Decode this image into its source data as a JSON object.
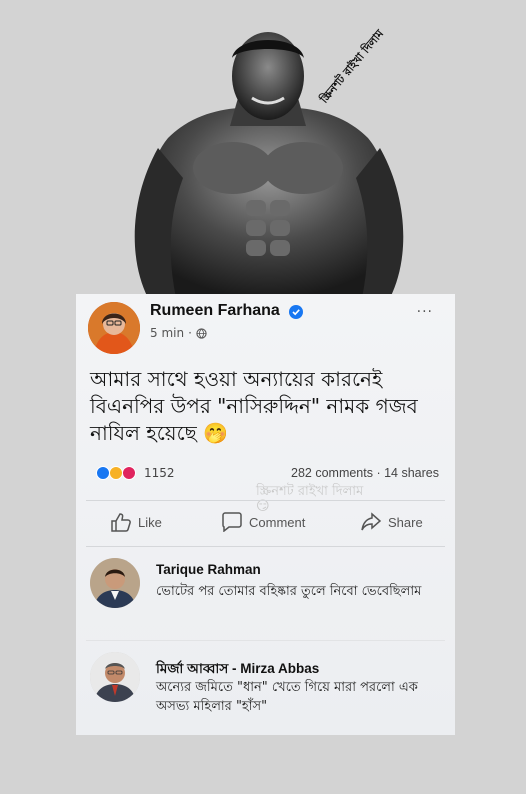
{
  "watermark_top": "স্ক্রিনশট রাইখা দিলাম",
  "post": {
    "author": "Rumeen Farhana",
    "time": "5 min",
    "more": "···",
    "text": "আমার সাথে হওয়া অন্যায়ের কারনেই বিএনপির উপর \"নাসিরুদ্দিন\" নামক গজব নাযিল হয়েছে 🤭",
    "reaction_count": "1152",
    "counts": "282 comments · 14 shares",
    "watermark": "স্ক্রিনশট রাইখা দিলাম😏",
    "actions": {
      "like": "Like",
      "comment": "Comment",
      "share": "Share"
    }
  },
  "comments": [
    {
      "name": "Tarique Rahman",
      "text": "ভোটের পর তোমার বহিষ্কার তুলে নিবো ভেবেছিলাম"
    },
    {
      "name": "মির্জা আব্বাস - Mirza Abbas",
      "text": "অন্যের জমিতে \"ধান\" খেতে গিয়ে মারা পরলো এক অসভ্য মহিলার \"হাঁস\""
    }
  ],
  "colors": {
    "verified": "#1877f2",
    "like_blue": "#1877f2",
    "love_red": "#e0245e",
    "haha_yellow": "#f7b125"
  }
}
